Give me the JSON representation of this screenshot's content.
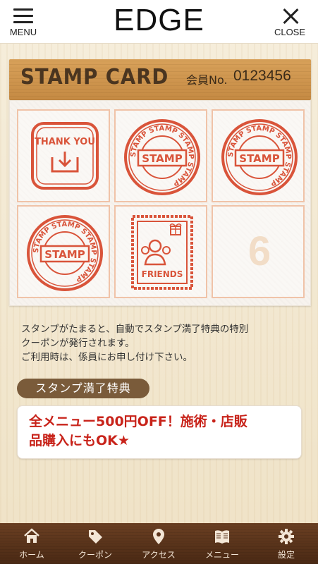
{
  "header": {
    "menu_label": "MENU",
    "title": "EDGE",
    "close_label": "CLOSE"
  },
  "card": {
    "title": "STAMP CARD",
    "member_label": "会員No.",
    "member_number": "0123456",
    "cells": [
      {
        "type": "thank-you",
        "text": "THANK YOU"
      },
      {
        "type": "stamp",
        "text": "STAMP"
      },
      {
        "type": "stamp",
        "text": "STAMP"
      },
      {
        "type": "stamp",
        "text": "STAMP"
      },
      {
        "type": "friends",
        "text": "FRIENDS"
      },
      {
        "type": "empty",
        "number": "6"
      }
    ],
    "stamp_ring_text": "STAMP STAMP STAMP STAMP",
    "accent_color": "#d9543a"
  },
  "description": {
    "line1": "スタンプがたまると、自動でスタンプ満了特典の特別",
    "line2": "クーポンが発行されます。",
    "line3": "ご利用時は、係員にお申し付け下さい。"
  },
  "reward": {
    "tab_label": "スタンプ満了特典",
    "line1": "全メニュー500円OFF！施術・店販",
    "line2": "品購入にもOK★"
  },
  "tabbar": {
    "items": [
      {
        "label": "ホーム",
        "icon": "home-icon"
      },
      {
        "label": "クーポン",
        "icon": "coupon-tag-icon"
      },
      {
        "label": "アクセス",
        "icon": "map-pin-icon"
      },
      {
        "label": "メニュー",
        "icon": "book-icon"
      },
      {
        "label": "設定",
        "icon": "gear-icon"
      }
    ]
  }
}
